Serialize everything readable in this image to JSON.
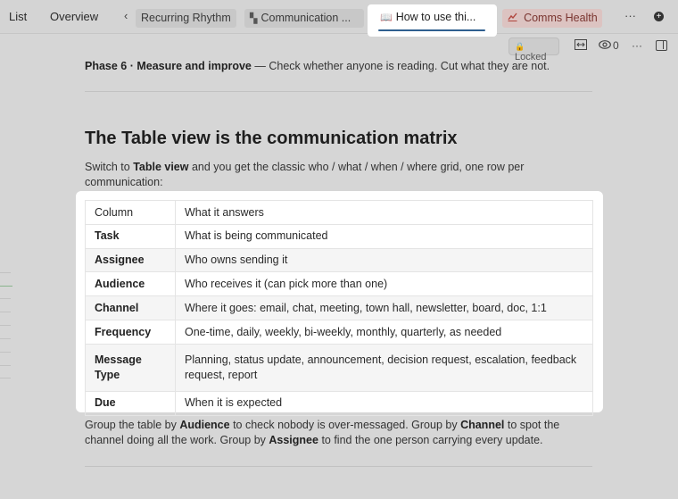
{
  "topbar": {
    "links": [
      "List",
      "Overview"
    ],
    "tabs": [
      {
        "label": "Recurring Rhythm",
        "icon": ""
      },
      {
        "label": "Communication ...",
        "icon": "page-icon"
      },
      {
        "label": "How to use thi...",
        "icon": "book-icon",
        "active": true
      },
      {
        "label": "Comms Health",
        "icon": "chart-line-icon"
      }
    ],
    "more": "···",
    "add": "+"
  },
  "toolbar": {
    "locked_label": "Locked",
    "views_count": "0",
    "more": "···"
  },
  "doc": {
    "phase_bold": "Phase 6 · Measure and improve",
    "phase_rest": " — Check whether anyone is reading. Cut what they are not.",
    "heading": "The Table view is the communication matrix",
    "intro_1": "Switch to ",
    "intro_bold": "Table view",
    "intro_2": " and you get the classic who / what / when / where grid, one row per communication:",
    "table": {
      "header": [
        "Column",
        "What it answers"
      ],
      "rows": [
        [
          "Task",
          "What is being communicated"
        ],
        [
          "Assignee",
          "Who owns sending it"
        ],
        [
          "Audience",
          "Who receives it (can pick more than one)"
        ],
        [
          "Channel",
          "Where it goes: email, chat, meeting, town hall, newsletter, board, doc, 1:1"
        ],
        [
          "Frequency",
          "One-time, daily, weekly, bi-weekly, monthly, quarterly, as needed"
        ],
        [
          "Message Type",
          "Planning, status update, announcement, decision request, escalation, feedback request, report"
        ],
        [
          "Due",
          "When it is expected"
        ]
      ]
    },
    "outro": {
      "p1": "Group the table by ",
      "b1": "Audience",
      "p2": " to check nobody is over-messaged. Group by ",
      "b2": "Channel",
      "p3": " to spot the channel doing all the work. Group by ",
      "b3": "Assignee",
      "p4": " to find the one person carrying every update."
    }
  },
  "colors": {
    "active_underline": "#2f5f8f",
    "health_tab_bg": "#dcc3c1",
    "health_tab_text": "#7a3530"
  }
}
